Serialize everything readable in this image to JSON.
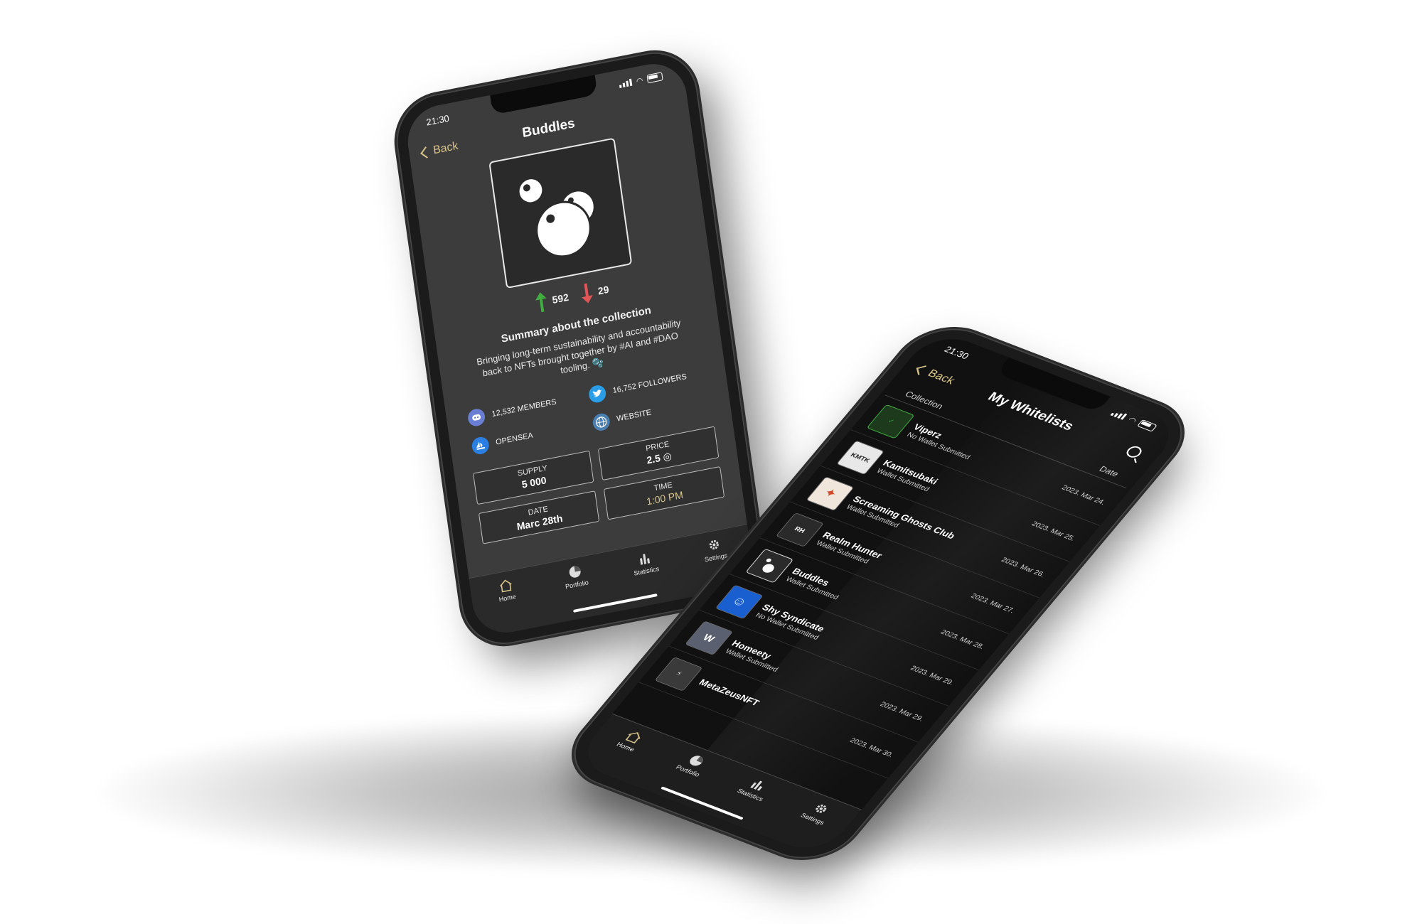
{
  "left_phone": {
    "status": {
      "time": "21:30"
    },
    "nav": {
      "back_label": "Back",
      "title": "Buddles"
    },
    "collection_logo": "buddles-bubbles-logo",
    "votes": {
      "up": "592",
      "down": "29",
      "up_color": "#3fae3f",
      "down_color": "#e05555"
    },
    "summary": {
      "title": "Summary about the collection",
      "text": "Bringing long-term sustainability and accountability back to NFTs  brought together by #AI and #DAO tooling. 🫧"
    },
    "socials": [
      {
        "icon": "discord-icon",
        "label": "12,532 MEMBERS",
        "color": "#6a7fd4"
      },
      {
        "icon": "twitter-icon",
        "label": "16,752 FOLLOWERS",
        "color": "#2a9de8"
      },
      {
        "icon": "opensea-icon",
        "label": "OPENSEA",
        "color": "#2a7fe0"
      },
      {
        "icon": "globe-icon",
        "label": "WEBSITE",
        "color": "#4a7fb0"
      }
    ],
    "stats": [
      {
        "label": "SUPPLY",
        "value": "5 000"
      },
      {
        "label": "PRICE",
        "value": "2.5 ◎"
      },
      {
        "label": "DATE",
        "value": "Marc 28th"
      },
      {
        "label": "TIME",
        "value": "1:00 PM"
      }
    ],
    "tabs": [
      {
        "icon": "home-icon",
        "label": "Home"
      },
      {
        "icon": "portfolio-pie-icon",
        "label": "Portfolio"
      },
      {
        "icon": "bar-chart-icon",
        "label": "Statistics"
      },
      {
        "icon": "gear-icon",
        "label": "Settings"
      }
    ]
  },
  "right_phone": {
    "status": {
      "time": "21:30"
    },
    "nav": {
      "back_label": "Back",
      "title": "My Whitelists"
    },
    "columns": {
      "collection": "Collection",
      "date": "Date"
    },
    "items": [
      {
        "name": "Viperz",
        "status": "No Wallet Submitted",
        "date": "2023. Mar 24."
      },
      {
        "name": "Kamitsubaki",
        "status": "Wallet Submitted",
        "date": "2023. Mar 25."
      },
      {
        "name": "Screaming Ghosts Club",
        "status": "Wallet Submitted",
        "date": "2023. Mar 26."
      },
      {
        "name": "Realm Hunter",
        "status": "Wallet Submitted",
        "date": "2023. Mar 27."
      },
      {
        "name": "Buddles",
        "status": "Wallet Submitted",
        "date": "2023. Mar 28."
      },
      {
        "name": "Shy Syndicate",
        "status": "No Wallet Submitted",
        "date": "2023. Mar 29."
      },
      {
        "name": "Homeety",
        "status": "Wallet Submitted",
        "date": "2023. Mar 29."
      },
      {
        "name": "MetaZeusNFT",
        "status": "",
        "date": "2023. Mar 30."
      }
    ],
    "tabs": [
      {
        "icon": "home-icon",
        "label": "Home"
      },
      {
        "icon": "portfolio-pie-icon",
        "label": "Portfolio"
      },
      {
        "icon": "bar-chart-icon",
        "label": "Statistics"
      },
      {
        "icon": "gear-icon",
        "label": "Settings"
      }
    ]
  }
}
